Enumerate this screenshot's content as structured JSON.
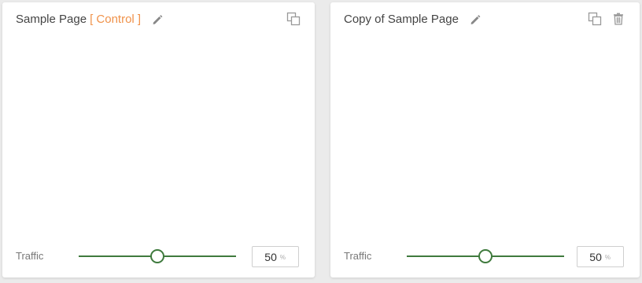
{
  "variants": [
    {
      "title": "Sample Page",
      "tag": "[ Control ]",
      "traffic_label": "Traffic",
      "traffic_value": "50",
      "traffic_unit": "%",
      "traffic_fraction": 0.5
    },
    {
      "title": "Copy of Sample Page",
      "tag": "",
      "traffic_label": "Traffic",
      "traffic_value": "50",
      "traffic_unit": "%",
      "traffic_fraction": 0.5
    }
  ],
  "icons": {
    "edit": "pencil-icon",
    "duplicate": "copy-icon",
    "delete": "trash-icon"
  },
  "colors": {
    "control_tag": "#f0924a",
    "slider": "#3f7a3d"
  }
}
